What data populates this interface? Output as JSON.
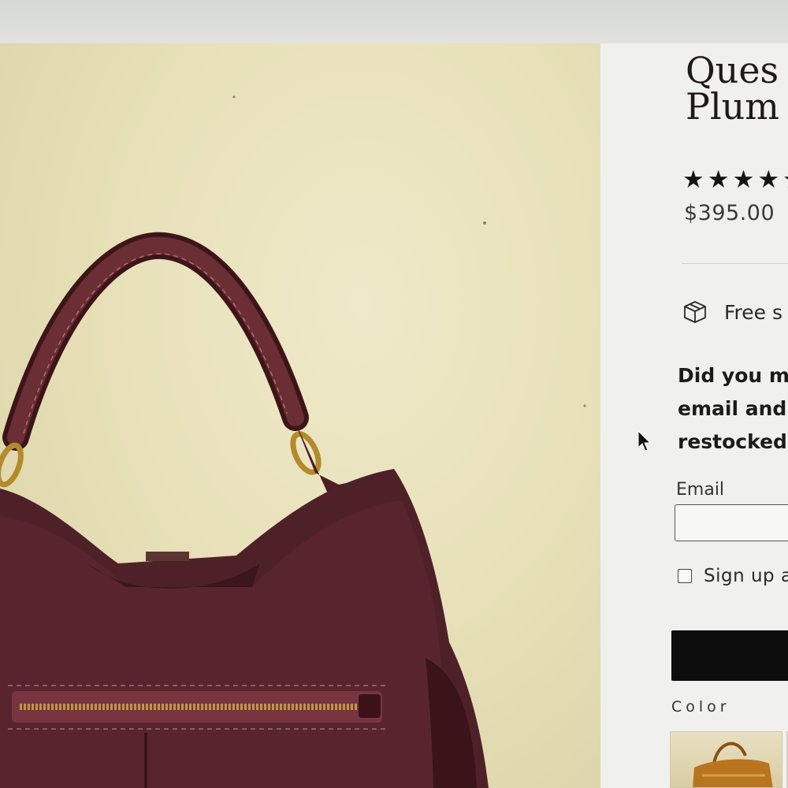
{
  "product": {
    "title": "Ques\nPlum",
    "rating": "★★★★★",
    "price": "$395.00"
  },
  "shipping": {
    "icon": "box-icon",
    "text": "Free s"
  },
  "restock": {
    "message": "Did you m\nemail and\nrestocked."
  },
  "email": {
    "label": "Email",
    "value": ""
  },
  "signup": {
    "label": "Sign up a",
    "checked": false
  },
  "color": {
    "label": "Color",
    "swatch_colors": [
      "#b9741f",
      "#5a1f2e"
    ]
  },
  "theme": {
    "button_color": "#0d0d0d",
    "bag_color": "#4e2129",
    "background_color": "#e6dfb6"
  }
}
